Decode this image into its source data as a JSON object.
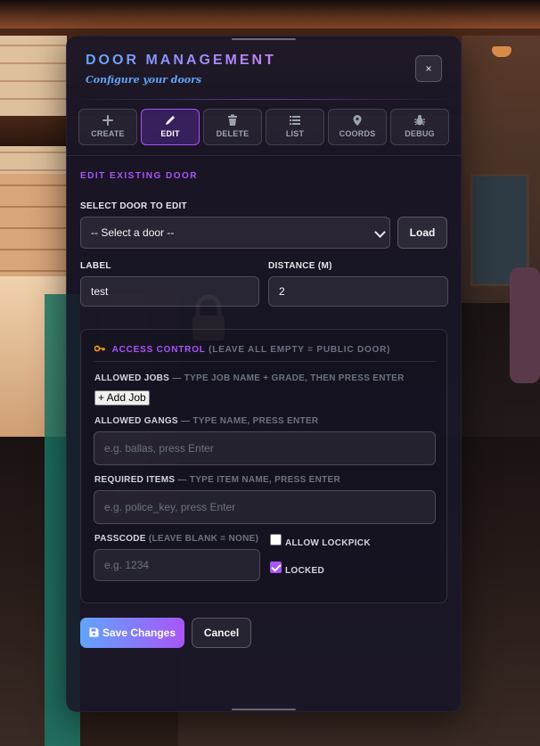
{
  "header": {
    "title": "DOOR MANAGEMENT",
    "subtitle": "Configure your doors",
    "close_label": "×"
  },
  "tabs": [
    {
      "label": "CREATE",
      "icon": "plus-icon",
      "active": false
    },
    {
      "label": "EDIT",
      "icon": "pencil-icon",
      "active": true
    },
    {
      "label": "DELETE",
      "icon": "trash-icon",
      "active": false
    },
    {
      "label": "LIST",
      "icon": "list-icon",
      "active": false
    },
    {
      "label": "COORDS",
      "icon": "map-pin-icon",
      "active": false
    },
    {
      "label": "DEBUG",
      "icon": "bug-icon",
      "active": false
    }
  ],
  "edit": {
    "section_title": "EDIT EXISTING DOOR",
    "select_label": "SELECT DOOR TO EDIT",
    "select_value": "-- Select a door --",
    "load_label": "Load",
    "label_label": "LABEL",
    "label_value": "test",
    "distance_label": "DISTANCE (M)",
    "distance_value": "2"
  },
  "access": {
    "icon": "key-icon",
    "title": "ACCESS CONTROL",
    "title_hint": "(LEAVE ALL EMPTY = PUBLIC DOOR)",
    "jobs_label": "ALLOWED JOBS",
    "jobs_hint": "— TYPE JOB NAME + GRADE, THEN PRESS ENTER",
    "add_job_label": "+ Add Job",
    "gangs_label": "ALLOWED GANGS",
    "gangs_hint": "— TYPE NAME, PRESS ENTER",
    "gangs_placeholder": "e.g. ballas, press Enter",
    "items_label": "REQUIRED ITEMS",
    "items_hint": "— TYPE ITEM NAME, PRESS ENTER",
    "items_placeholder": "e.g. police_key, press Enter",
    "passcode_label": "PASSCODE",
    "passcode_hint": "(LEAVE BLANK = NONE)",
    "passcode_placeholder": "e.g. 1234",
    "lockpick_label": "ALLOW LOCKPICK",
    "lockpick_checked": false,
    "locked_label": "LOCKED",
    "locked_checked": true
  },
  "actions": {
    "save_label": "Save Changes",
    "cancel_label": "Cancel"
  },
  "colors": {
    "accent": "#a855f7",
    "accent_blue": "#60a5fa",
    "panel_bg": "#181628"
  }
}
